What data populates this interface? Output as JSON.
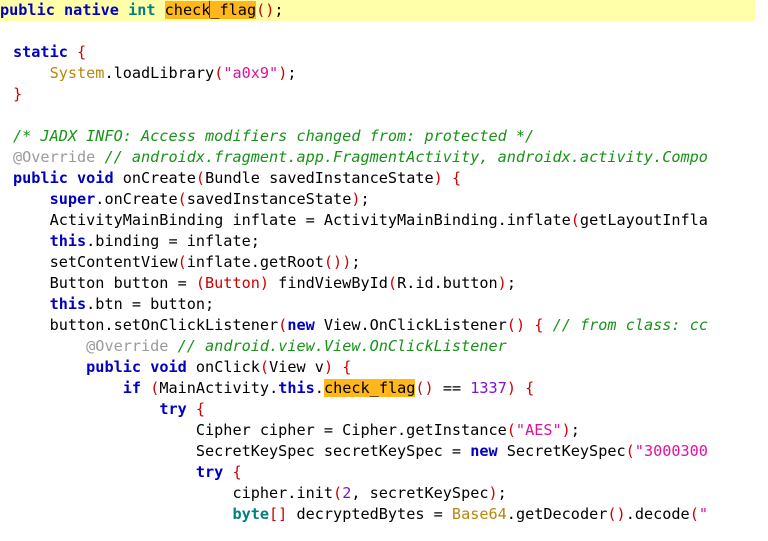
{
  "editor": {
    "name": "jadx-decompiled-java-source-view",
    "language": "java",
    "colors": {
      "background": "#ffffff",
      "current_line_highlight": "#ffffaa",
      "search_match_highlight": "#ffb71b",
      "caret": "#d40000",
      "keyword": "#0000c0",
      "type": "#008080",
      "string": "#e0119d",
      "number": "#7b11e0",
      "comment": "#179317",
      "annotation": "#9a9a9a",
      "class_reference": "#b8860b",
      "punctuation": "#cc0000",
      "plain_text": "#000000"
    },
    "search_term": "check_flag",
    "caret_text": "check|_flag"
  },
  "lines": [
    {
      "id": "line-1",
      "highlighted": true,
      "plain_text": "public native int check_flag();",
      "tokens": [
        {
          "t": "public",
          "c": "keyword"
        },
        {
          "t": " ",
          "c": "plain"
        },
        {
          "t": "native",
          "c": "keyword"
        },
        {
          "t": " ",
          "c": "plain"
        },
        {
          "t": "int",
          "c": "type"
        },
        {
          "t": " ",
          "c": "plain"
        },
        {
          "t": "check",
          "c": "match"
        },
        {
          "t": "CARET",
          "c": "caret"
        },
        {
          "t": "_flag",
          "c": "match"
        },
        {
          "t": "()",
          "c": "punct"
        },
        {
          "t": ";",
          "c": "plain"
        }
      ]
    },
    {
      "id": "line-2",
      "highlighted": false,
      "plain_text": "",
      "tokens": []
    },
    {
      "id": "line-3",
      "highlighted": false,
      "plain_text": "static {",
      "tokens": [
        {
          "t": "static",
          "c": "keyword"
        },
        {
          "t": " ",
          "c": "plain"
        },
        {
          "t": "{",
          "c": "punct"
        }
      ]
    },
    {
      "id": "line-4",
      "highlighted": false,
      "plain_text": "    System.loadLibrary(\"a0x9\");",
      "tokens": [
        {
          "t": "    ",
          "c": "plain"
        },
        {
          "t": "System",
          "c": "classref"
        },
        {
          "t": ".loadLibrary",
          "c": "plain"
        },
        {
          "t": "(",
          "c": "punct"
        },
        {
          "t": "\"a0x9\"",
          "c": "string"
        },
        {
          "t": ")",
          "c": "punct"
        },
        {
          "t": ";",
          "c": "plain"
        }
      ]
    },
    {
      "id": "line-5",
      "highlighted": false,
      "plain_text": "}",
      "tokens": [
        {
          "t": "}",
          "c": "punct"
        }
      ]
    },
    {
      "id": "line-6",
      "highlighted": false,
      "plain_text": "",
      "tokens": []
    },
    {
      "id": "line-7",
      "highlighted": false,
      "plain_text": "/* JADX INFO: Access modifiers changed from: protected */",
      "tokens": [
        {
          "t": "/* JADX INFO: Access modifiers changed from: protected */",
          "c": "comment"
        }
      ]
    },
    {
      "id": "line-8",
      "highlighted": false,
      "plain_text": "@Override // androidx.fragment.app.FragmentActivity, androidx.activity.Compo",
      "tokens": [
        {
          "t": "@Override",
          "c": "anno"
        },
        {
          "t": " ",
          "c": "plain"
        },
        {
          "t": "// androidx.fragment.app.FragmentActivity, androidx.activity.Compo",
          "c": "comment"
        }
      ]
    },
    {
      "id": "line-9",
      "highlighted": false,
      "plain_text": "public void onCreate(Bundle savedInstanceState) {",
      "tokens": [
        {
          "t": "public",
          "c": "keyword"
        },
        {
          "t": " ",
          "c": "plain"
        },
        {
          "t": "void",
          "c": "keyword"
        },
        {
          "t": " onCreate",
          "c": "plain"
        },
        {
          "t": "(",
          "c": "punct"
        },
        {
          "t": "Bundle savedInstanceState",
          "c": "plain"
        },
        {
          "t": ")",
          "c": "punct"
        },
        {
          "t": " ",
          "c": "plain"
        },
        {
          "t": "{",
          "c": "punct"
        }
      ]
    },
    {
      "id": "line-10",
      "highlighted": false,
      "plain_text": "    super.onCreate(savedInstanceState);",
      "tokens": [
        {
          "t": "    ",
          "c": "plain"
        },
        {
          "t": "super",
          "c": "keyword"
        },
        {
          "t": ".onCreate",
          "c": "plain"
        },
        {
          "t": "(",
          "c": "punct"
        },
        {
          "t": "savedInstanceState",
          "c": "plain"
        },
        {
          "t": ")",
          "c": "punct"
        },
        {
          "t": ";",
          "c": "plain"
        }
      ]
    },
    {
      "id": "line-11",
      "highlighted": false,
      "plain_text": "    ActivityMainBinding inflate = ActivityMainBinding.inflate(getLayoutInfla",
      "tokens": [
        {
          "t": "    ActivityMainBinding inflate = ActivityMainBinding.inflate",
          "c": "plain"
        },
        {
          "t": "(",
          "c": "punct"
        },
        {
          "t": "getLayoutInfla",
          "c": "plain"
        }
      ]
    },
    {
      "id": "line-12",
      "highlighted": false,
      "plain_text": "    this.binding = inflate;",
      "tokens": [
        {
          "t": "    ",
          "c": "plain"
        },
        {
          "t": "this",
          "c": "keyword"
        },
        {
          "t": ".binding = inflate;",
          "c": "plain"
        }
      ]
    },
    {
      "id": "line-13",
      "highlighted": false,
      "plain_text": "    setContentView(inflate.getRoot());",
      "tokens": [
        {
          "t": "    setContentView",
          "c": "plain"
        },
        {
          "t": "(",
          "c": "punct"
        },
        {
          "t": "inflate.getRoot",
          "c": "plain"
        },
        {
          "t": "())",
          "c": "punct"
        },
        {
          "t": ";",
          "c": "plain"
        }
      ]
    },
    {
      "id": "line-14",
      "highlighted": false,
      "plain_text": "    Button button = (Button) findViewById(R.id.button);",
      "tokens": [
        {
          "t": "    Button button = ",
          "c": "plain"
        },
        {
          "t": "(Button)",
          "c": "punct"
        },
        {
          "t": " findViewById",
          "c": "plain"
        },
        {
          "t": "(",
          "c": "punct"
        },
        {
          "t": "R.id.button",
          "c": "plain"
        },
        {
          "t": ")",
          "c": "punct"
        },
        {
          "t": ";",
          "c": "plain"
        }
      ]
    },
    {
      "id": "line-15",
      "highlighted": false,
      "plain_text": "    this.btn = button;",
      "tokens": [
        {
          "t": "    ",
          "c": "plain"
        },
        {
          "t": "this",
          "c": "keyword"
        },
        {
          "t": ".btn = button;",
          "c": "plain"
        }
      ]
    },
    {
      "id": "line-16",
      "highlighted": false,
      "plain_text": "    button.setOnClickListener(new View.OnClickListener() { // from class: cc",
      "tokens": [
        {
          "t": "    button.setOnClickListener",
          "c": "plain"
        },
        {
          "t": "(",
          "c": "punct"
        },
        {
          "t": "new",
          "c": "keyword"
        },
        {
          "t": " View.OnClickListener",
          "c": "plain"
        },
        {
          "t": "()",
          "c": "punct"
        },
        {
          "t": " ",
          "c": "plain"
        },
        {
          "t": "{",
          "c": "punct"
        },
        {
          "t": " ",
          "c": "plain"
        },
        {
          "t": "// from class: cc",
          "c": "comment"
        }
      ]
    },
    {
      "id": "line-17",
      "highlighted": false,
      "plain_text": "        @Override // android.view.View.OnClickListener",
      "tokens": [
        {
          "t": "        ",
          "c": "plain"
        },
        {
          "t": "@Override",
          "c": "anno"
        },
        {
          "t": " ",
          "c": "plain"
        },
        {
          "t": "// android.view.View.OnClickListener",
          "c": "comment"
        }
      ]
    },
    {
      "id": "line-18",
      "highlighted": false,
      "plain_text": "        public void onClick(View v) {",
      "tokens": [
        {
          "t": "        ",
          "c": "plain"
        },
        {
          "t": "public",
          "c": "keyword"
        },
        {
          "t": " ",
          "c": "plain"
        },
        {
          "t": "void",
          "c": "keyword"
        },
        {
          "t": " onClick",
          "c": "plain"
        },
        {
          "t": "(",
          "c": "punct"
        },
        {
          "t": "View v",
          "c": "plain"
        },
        {
          "t": ")",
          "c": "punct"
        },
        {
          "t": " ",
          "c": "plain"
        },
        {
          "t": "{",
          "c": "punct"
        }
      ]
    },
    {
      "id": "line-19",
      "highlighted": false,
      "plain_text": "            if (MainActivity.this.check_flag() == 1337) {",
      "tokens": [
        {
          "t": "            ",
          "c": "plain"
        },
        {
          "t": "if",
          "c": "keyword"
        },
        {
          "t": " ",
          "c": "plain"
        },
        {
          "t": "(",
          "c": "punct"
        },
        {
          "t": "MainActivity.",
          "c": "plain"
        },
        {
          "t": "this",
          "c": "keyword"
        },
        {
          "t": ".",
          "c": "plain"
        },
        {
          "t": "check_flag",
          "c": "match"
        },
        {
          "t": "()",
          "c": "punct"
        },
        {
          "t": " == ",
          "c": "plain"
        },
        {
          "t": "1337",
          "c": "number"
        },
        {
          "t": ")",
          "c": "punct"
        },
        {
          "t": " ",
          "c": "plain"
        },
        {
          "t": "{",
          "c": "punct"
        }
      ]
    },
    {
      "id": "line-20",
      "highlighted": false,
      "plain_text": "                try {",
      "tokens": [
        {
          "t": "                ",
          "c": "plain"
        },
        {
          "t": "try",
          "c": "keyword"
        },
        {
          "t": " ",
          "c": "plain"
        },
        {
          "t": "{",
          "c": "punct"
        }
      ]
    },
    {
      "id": "line-21",
      "highlighted": false,
      "plain_text": "                    Cipher cipher = Cipher.getInstance(\"AES\");",
      "tokens": [
        {
          "t": "                    Cipher cipher = Cipher.getInstance",
          "c": "plain"
        },
        {
          "t": "(",
          "c": "punct"
        },
        {
          "t": "\"AES\"",
          "c": "string"
        },
        {
          "t": ")",
          "c": "punct"
        },
        {
          "t": ";",
          "c": "plain"
        }
      ]
    },
    {
      "id": "line-22",
      "highlighted": false,
      "plain_text": "                    SecretKeySpec secretKeySpec = new SecretKeySpec(\"3000300",
      "tokens": [
        {
          "t": "                    SecretKeySpec secretKeySpec = ",
          "c": "plain"
        },
        {
          "t": "new",
          "c": "keyword"
        },
        {
          "t": " SecretKeySpec",
          "c": "plain"
        },
        {
          "t": "(",
          "c": "punct"
        },
        {
          "t": "\"3000300",
          "c": "string"
        }
      ]
    },
    {
      "id": "line-23",
      "highlighted": false,
      "plain_text": "                    try {",
      "tokens": [
        {
          "t": "                    ",
          "c": "plain"
        },
        {
          "t": "try",
          "c": "keyword"
        },
        {
          "t": " ",
          "c": "plain"
        },
        {
          "t": "{",
          "c": "punct"
        }
      ]
    },
    {
      "id": "line-24",
      "highlighted": false,
      "plain_text": "                        cipher.init(2, secretKeySpec);",
      "tokens": [
        {
          "t": "                        cipher.init",
          "c": "plain"
        },
        {
          "t": "(",
          "c": "punct"
        },
        {
          "t": "2",
          "c": "number"
        },
        {
          "t": ", secretKeySpec",
          "c": "plain"
        },
        {
          "t": ")",
          "c": "punct"
        },
        {
          "t": ";",
          "c": "plain"
        }
      ]
    },
    {
      "id": "line-25",
      "highlighted": false,
      "plain_text": "                        byte[] decryptedBytes = Base64.getDecoder().decode(\"",
      "tokens": [
        {
          "t": "                        ",
          "c": "plain"
        },
        {
          "t": "byte",
          "c": "type"
        },
        {
          "t": "[]",
          "c": "punct"
        },
        {
          "t": " decryptedBytes = ",
          "c": "plain"
        },
        {
          "t": "Base64",
          "c": "classref"
        },
        {
          "t": ".getDecoder",
          "c": "plain"
        },
        {
          "t": "()",
          "c": "punct"
        },
        {
          "t": ".decode",
          "c": "plain"
        },
        {
          "t": "(",
          "c": "punct"
        },
        {
          "t": "\"",
          "c": "string"
        }
      ]
    }
  ]
}
